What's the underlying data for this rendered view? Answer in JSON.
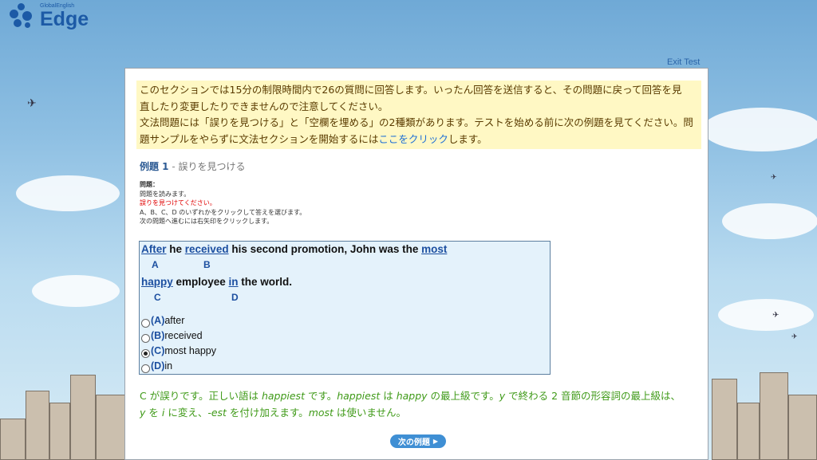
{
  "logo": {
    "small": "GlobalEnglish",
    "brand": "Edge"
  },
  "exit_label": "Exit Test",
  "notice": {
    "line1": "このセクションでは15分の制限時間内で26の質問に回答します。いったん回答を送信すると、その問題に戻って回答を見",
    "line2": "直したり変更したりできませんので注意してください。",
    "line3": "文法問題には「誤りを見つける」と「空欄を埋める」の2種類があります。テストを始める前に次の例題を見てください。問",
    "line4_pre": "題サンプルをやらずに文法セクションを開始するには",
    "line4_link": "ここをクリック",
    "line4_post": "します。"
  },
  "example": {
    "label": "例題 1",
    "sep": " - ",
    "title": "誤りを見つける"
  },
  "instructions": {
    "head": "問題：",
    "l1": "問題を読みます。",
    "l2": "誤りを見つけてください。",
    "l3": "A、B、C、D のいずれかをクリックして答えを選びます。",
    "l4": "次の問題へ進むには右矢印をクリックします。"
  },
  "question": {
    "w_after": "After",
    "t1": " he ",
    "w_received": "received",
    "t2": " his second promotion, John was the ",
    "w_most": "most",
    "w_happy": "happy",
    "t3": " employee ",
    "w_in": "in",
    "t4": " the world.",
    "letters": [
      "A",
      "B",
      "C",
      "D"
    ]
  },
  "options": [
    {
      "letter": "(A)",
      "text": "after",
      "selected": false
    },
    {
      "letter": "(B)",
      "text": "received",
      "selected": false
    },
    {
      "letter": "(C)",
      "text": "most happy",
      "selected": true
    },
    {
      "letter": "(D)",
      "text": "in",
      "selected": false
    }
  ],
  "answer": {
    "a1": "C が誤りです。正しい語は ",
    "a2": "happiest",
    "a3": " です。",
    "a4": "happiest",
    "a5": " は ",
    "a6": "happy",
    "a7": " の最上級です。",
    "a8": "y",
    "a9": " で終わる 2 音節の形容詞の最上級は、",
    "b1": "y",
    "b2": " を ",
    "b3": "i",
    "b4": " に変え、",
    "b5": "-est",
    "b6": " を付け加えます。",
    "b7": "most",
    "b8": " は使いません。"
  },
  "next_button": "次の例題"
}
